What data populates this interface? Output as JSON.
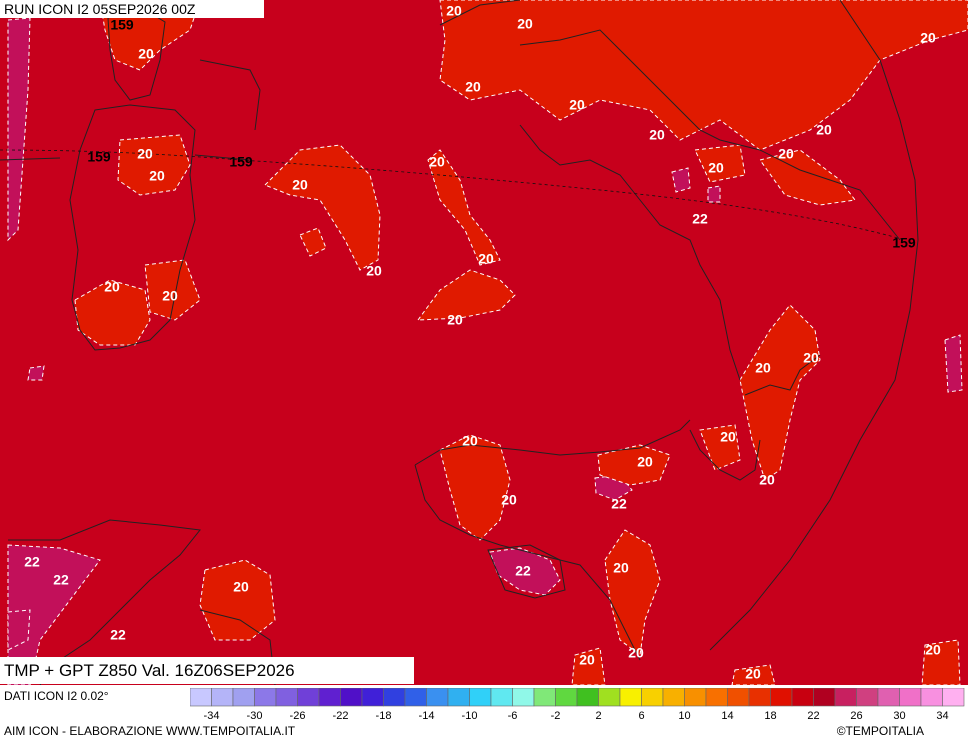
{
  "header": {
    "run": "RUN ICON I2 05SEP2026 00Z",
    "title": "TMP + GPT Z850 Val. 16Z06SEP2026"
  },
  "footer": {
    "data_source": "DATI ICON I2 0.02°",
    "credit": "AIM ICON - ELABORAZIONE WWW.TEMPOITALIA.IT",
    "brand": "©TEMPOITALIA"
  },
  "colors": {
    "map_base": "#c7001c",
    "contour_20": "#e01a00",
    "contour_22": "#c2105a",
    "coast": "#222222"
  },
  "map_labels": [
    {
      "text": "20",
      "kind": "temp"
    },
    {
      "text": "20",
      "kind": "temp"
    },
    {
      "text": "20",
      "kind": "temp"
    },
    {
      "text": "20",
      "kind": "temp"
    },
    {
      "text": "20",
      "kind": "temp"
    },
    {
      "text": "20",
      "kind": "temp"
    },
    {
      "text": "20",
      "kind": "temp"
    },
    {
      "text": "20",
      "kind": "temp"
    },
    {
      "text": "20",
      "kind": "temp"
    },
    {
      "text": "20",
      "kind": "temp"
    },
    {
      "text": "20",
      "kind": "temp"
    },
    {
      "text": "20",
      "kind": "temp"
    },
    {
      "text": "20",
      "kind": "temp"
    },
    {
      "text": "20",
      "kind": "temp"
    },
    {
      "text": "20",
      "kind": "temp"
    },
    {
      "text": "20",
      "kind": "temp"
    },
    {
      "text": "20",
      "kind": "temp"
    },
    {
      "text": "20",
      "kind": "temp"
    },
    {
      "text": "20",
      "kind": "temp"
    },
    {
      "text": "20",
      "kind": "temp"
    },
    {
      "text": "20",
      "kind": "temp"
    },
    {
      "text": "20",
      "kind": "temp"
    },
    {
      "text": "20",
      "kind": "temp"
    },
    {
      "text": "20",
      "kind": "temp"
    },
    {
      "text": "20",
      "kind": "temp"
    },
    {
      "text": "20",
      "kind": "temp"
    },
    {
      "text": "20",
      "kind": "temp"
    },
    {
      "text": "20",
      "kind": "temp"
    },
    {
      "text": "20",
      "kind": "temp"
    },
    {
      "text": "20",
      "kind": "temp"
    },
    {
      "text": "20",
      "kind": "temp"
    },
    {
      "text": "20",
      "kind": "temp"
    },
    {
      "text": "22",
      "kind": "temp"
    },
    {
      "text": "22",
      "kind": "temp"
    },
    {
      "text": "22",
      "kind": "temp"
    },
    {
      "text": "22",
      "kind": "temp"
    },
    {
      "text": "22",
      "kind": "temp"
    },
    {
      "text": "22",
      "kind": "temp"
    },
    {
      "text": "159",
      "kind": "gpt"
    },
    {
      "text": "159",
      "kind": "gpt"
    },
    {
      "text": "159",
      "kind": "gpt"
    },
    {
      "text": "159",
      "kind": "gpt"
    }
  ],
  "colorbar": {
    "colors": [
      "#c8c8ff",
      "#b4b4f8",
      "#a0a0f0",
      "#8c78e8",
      "#8060e0",
      "#7040d8",
      "#6020d0",
      "#5010c8",
      "#4020d8",
      "#3040e0",
      "#3060e8",
      "#3a90f0",
      "#30b0f0",
      "#30d0f8",
      "#60e8f0",
      "#90f8e8",
      "#80e878",
      "#60d840",
      "#40c020",
      "#a0e020",
      "#f8f000",
      "#f8d000",
      "#f8b000",
      "#f89000",
      "#f87000",
      "#f05000",
      "#e83000",
      "#e01000",
      "#c80010",
      "#b00020",
      "#c82060",
      "#d04080",
      "#e060b0",
      "#f070c8",
      "#f890e0",
      "#ffb0f0"
    ],
    "tick_labels": [
      "-34",
      "-30",
      "-26",
      "-22",
      "-18",
      "-14",
      "-10",
      "-6",
      "-2",
      "2",
      "6",
      "10",
      "14",
      "18",
      "22",
      "26",
      "30",
      "34"
    ]
  }
}
